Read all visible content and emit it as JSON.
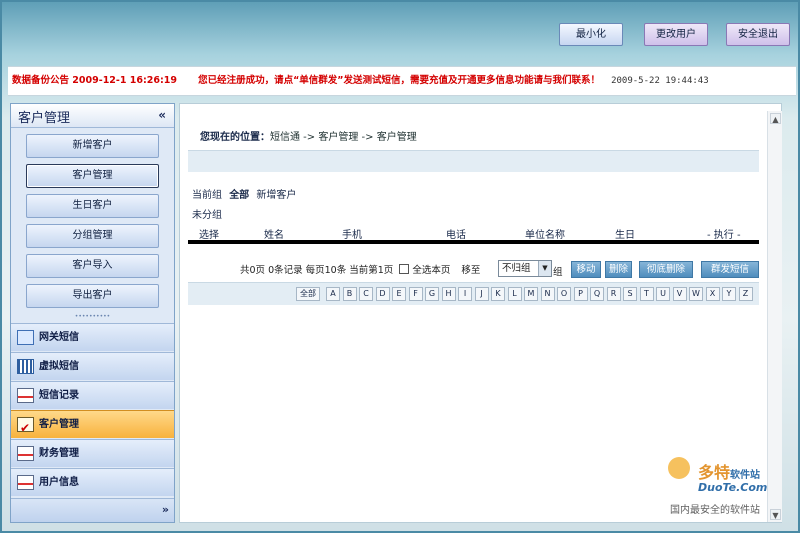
{
  "header": {
    "buttons": [
      "最小化",
      "更改用户",
      "安全退出"
    ]
  },
  "notice": {
    "announcement": "数据备份公告 2009-12-1 16:26:19",
    "message": "您已经注册成功，请点“单信群发”发送测试短信，需要充值及开通更多信息功能请与我们联系！",
    "timestamp": "2009-5-22 19:44:43"
  },
  "sidebar": {
    "title": "客户管理",
    "collapse_icon": "«",
    "submenu": [
      "新增客户",
      "客户管理",
      "生日客户",
      "分组管理",
      "客户导入",
      "导出客户"
    ],
    "active_submenu": "客户管理",
    "grip": "••••••••••",
    "nav": [
      {
        "label": "网关短信",
        "icon": "envelope-icon"
      },
      {
        "label": "虚拟短信",
        "icon": "grid-icon"
      },
      {
        "label": "短信记录",
        "icon": "card-icon"
      },
      {
        "label": "客户管理",
        "icon": "checklist-icon",
        "active": true
      },
      {
        "label": "财务管理",
        "icon": "card-icon"
      },
      {
        "label": "用户信息",
        "icon": "card-icon"
      }
    ],
    "footer_more": "»"
  },
  "main": {
    "breadcrumb_label": "您现在的位置：",
    "breadcrumb_path": "短信通 -> 客户管理 -> 客户管理",
    "current_group_label": "当前组",
    "group_all": "全部",
    "group_new": "新增客户",
    "ungrouped": "未分组",
    "columns": [
      "选择",
      "姓名",
      "手机",
      "电话",
      "单位名称",
      "生日",
      "- 执行 -"
    ],
    "pager_text": "共0页  0条记录  每页10条  当前第1页",
    "select_all_label": "全选本页",
    "move_label": "移至",
    "group_select_value": "不归组",
    "group_suffix": "组",
    "actions": [
      "移动",
      "删除",
      "彻底删除",
      "群发短信"
    ],
    "letters": [
      "全部",
      "A",
      "B",
      "C",
      "D",
      "E",
      "F",
      "G",
      "H",
      "I",
      "J",
      "K",
      "L",
      "M",
      "N",
      "O",
      "P",
      "Q",
      "R",
      "S",
      "T",
      "U",
      "V",
      "W",
      "X",
      "Y",
      "Z"
    ]
  },
  "watermark": {
    "brand_cn": "多特",
    "brand_suffix": "软件站",
    "brand_en": "DuoTe.Com",
    "slogan": "国内最安全的软件站"
  },
  "colors": {
    "accent": "#4f8dbd",
    "notice_red": "#d40000",
    "active_nav": "#f8b23d"
  }
}
